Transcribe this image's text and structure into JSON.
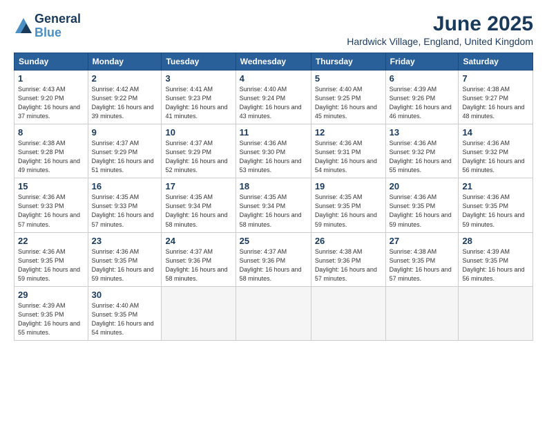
{
  "logo": {
    "line1": "General",
    "line2": "Blue"
  },
  "title": "June 2025",
  "subtitle": "Hardwick Village, England, United Kingdom",
  "days_header": [
    "Sunday",
    "Monday",
    "Tuesday",
    "Wednesday",
    "Thursday",
    "Friday",
    "Saturday"
  ],
  "weeks": [
    [
      {
        "num": "1",
        "rise": "4:43 AM",
        "set": "9:20 PM",
        "daylight": "16 hours and 37 minutes."
      },
      {
        "num": "2",
        "rise": "4:42 AM",
        "set": "9:22 PM",
        "daylight": "16 hours and 39 minutes."
      },
      {
        "num": "3",
        "rise": "4:41 AM",
        "set": "9:23 PM",
        "daylight": "16 hours and 41 minutes."
      },
      {
        "num": "4",
        "rise": "4:40 AM",
        "set": "9:24 PM",
        "daylight": "16 hours and 43 minutes."
      },
      {
        "num": "5",
        "rise": "4:40 AM",
        "set": "9:25 PM",
        "daylight": "16 hours and 45 minutes."
      },
      {
        "num": "6",
        "rise": "4:39 AM",
        "set": "9:26 PM",
        "daylight": "16 hours and 46 minutes."
      },
      {
        "num": "7",
        "rise": "4:38 AM",
        "set": "9:27 PM",
        "daylight": "16 hours and 48 minutes."
      }
    ],
    [
      {
        "num": "8",
        "rise": "4:38 AM",
        "set": "9:28 PM",
        "daylight": "16 hours and 49 minutes."
      },
      {
        "num": "9",
        "rise": "4:37 AM",
        "set": "9:29 PM",
        "daylight": "16 hours and 51 minutes."
      },
      {
        "num": "10",
        "rise": "4:37 AM",
        "set": "9:29 PM",
        "daylight": "16 hours and 52 minutes."
      },
      {
        "num": "11",
        "rise": "4:36 AM",
        "set": "9:30 PM",
        "daylight": "16 hours and 53 minutes."
      },
      {
        "num": "12",
        "rise": "4:36 AM",
        "set": "9:31 PM",
        "daylight": "16 hours and 54 minutes."
      },
      {
        "num": "13",
        "rise": "4:36 AM",
        "set": "9:32 PM",
        "daylight": "16 hours and 55 minutes."
      },
      {
        "num": "14",
        "rise": "4:36 AM",
        "set": "9:32 PM",
        "daylight": "16 hours and 56 minutes."
      }
    ],
    [
      {
        "num": "15",
        "rise": "4:36 AM",
        "set": "9:33 PM",
        "daylight": "16 hours and 57 minutes."
      },
      {
        "num": "16",
        "rise": "4:35 AM",
        "set": "9:33 PM",
        "daylight": "16 hours and 57 minutes."
      },
      {
        "num": "17",
        "rise": "4:35 AM",
        "set": "9:34 PM",
        "daylight": "16 hours and 58 minutes."
      },
      {
        "num": "18",
        "rise": "4:35 AM",
        "set": "9:34 PM",
        "daylight": "16 hours and 58 minutes."
      },
      {
        "num": "19",
        "rise": "4:35 AM",
        "set": "9:35 PM",
        "daylight": "16 hours and 59 minutes."
      },
      {
        "num": "20",
        "rise": "4:36 AM",
        "set": "9:35 PM",
        "daylight": "16 hours and 59 minutes."
      },
      {
        "num": "21",
        "rise": "4:36 AM",
        "set": "9:35 PM",
        "daylight": "16 hours and 59 minutes."
      }
    ],
    [
      {
        "num": "22",
        "rise": "4:36 AM",
        "set": "9:35 PM",
        "daylight": "16 hours and 59 minutes."
      },
      {
        "num": "23",
        "rise": "4:36 AM",
        "set": "9:35 PM",
        "daylight": "16 hours and 59 minutes."
      },
      {
        "num": "24",
        "rise": "4:37 AM",
        "set": "9:36 PM",
        "daylight": "16 hours and 58 minutes."
      },
      {
        "num": "25",
        "rise": "4:37 AM",
        "set": "9:36 PM",
        "daylight": "16 hours and 58 minutes."
      },
      {
        "num": "26",
        "rise": "4:38 AM",
        "set": "9:36 PM",
        "daylight": "16 hours and 57 minutes."
      },
      {
        "num": "27",
        "rise": "4:38 AM",
        "set": "9:35 PM",
        "daylight": "16 hours and 57 minutes."
      },
      {
        "num": "28",
        "rise": "4:39 AM",
        "set": "9:35 PM",
        "daylight": "16 hours and 56 minutes."
      }
    ],
    [
      {
        "num": "29",
        "rise": "4:39 AM",
        "set": "9:35 PM",
        "daylight": "16 hours and 55 minutes."
      },
      {
        "num": "30",
        "rise": "4:40 AM",
        "set": "9:35 PM",
        "daylight": "16 hours and 54 minutes."
      },
      null,
      null,
      null,
      null,
      null
    ]
  ]
}
